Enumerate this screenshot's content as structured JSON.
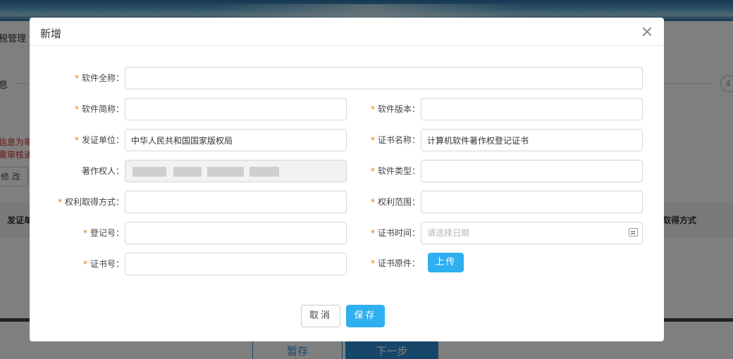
{
  "background": {
    "breadcrumb": "税管理",
    "step_label": "息",
    "step_number": "4",
    "notice_line1": "信息为审",
    "notice_line2": "需审核通",
    "edit_button": "修 改",
    "table_col_left": "发证单",
    "table_col_right": "取得方式",
    "save_draft_button": "暂存",
    "next_step_button": "下一步"
  },
  "dialog": {
    "title": "新增",
    "fields": {
      "software_full_name": {
        "label": "软件全称：",
        "required": true,
        "value": ""
      },
      "software_short_name": {
        "label": "软件简称：",
        "required": true,
        "value": ""
      },
      "software_version": {
        "label": "软件版本：",
        "required": true,
        "value": ""
      },
      "issuing_unit": {
        "label": "发证单位：",
        "required": true,
        "value": "中华人民共和国国家版权局"
      },
      "certificate_name": {
        "label": "证书名称：",
        "required": true,
        "value": "计算机软件著作权登记证书"
      },
      "copyright_owner": {
        "label": "著作权人：",
        "required": false,
        "value": ""
      },
      "software_type": {
        "label": "软件类型：",
        "required": true,
        "value": ""
      },
      "acquisition_method": {
        "label": "权利取得方式：",
        "required": true,
        "value": ""
      },
      "rights_scope": {
        "label": "权利范围：",
        "required": true,
        "value": ""
      },
      "registration_number": {
        "label": "登记号：",
        "required": true,
        "value": ""
      },
      "certificate_date": {
        "label": "证书时间：",
        "required": true,
        "value": "",
        "placeholder": "请选择日期"
      },
      "certificate_number": {
        "label": "证书号：",
        "required": true,
        "value": ""
      },
      "certificate_original": {
        "label": "证书原件：",
        "required": true
      }
    },
    "required_mark": "*",
    "upload_button": "上传",
    "cancel_button": "取消",
    "save_button": "保存"
  }
}
